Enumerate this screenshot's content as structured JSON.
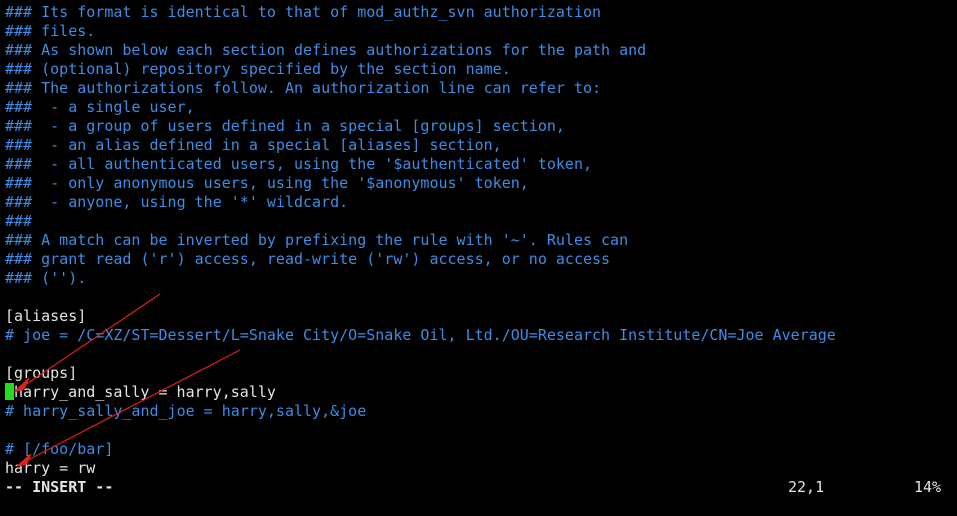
{
  "editor": {
    "mode": "terminal-vim",
    "colors": {
      "background": "#000000",
      "comment": "#3d8de6",
      "text": "#e5e5e5",
      "cursor": "#22dd22",
      "annotation_arrow": "#e0201a"
    }
  },
  "lines": [
    {
      "text": "### Its format is identical to that of mod_authz_svn authorization",
      "kind": "comment"
    },
    {
      "text": "### files.",
      "kind": "comment"
    },
    {
      "text": "### As shown below each section defines authorizations for the path and",
      "kind": "comment"
    },
    {
      "text": "### (optional) repository specified by the section name.",
      "kind": "comment"
    },
    {
      "text": "### The authorizations follow. An authorization line can refer to:",
      "kind": "comment"
    },
    {
      "text": "###  - a single user,",
      "kind": "comment"
    },
    {
      "text": "###  - a group of users defined in a special [groups] section,",
      "kind": "comment"
    },
    {
      "text": "###  - an alias defined in a special [aliases] section,",
      "kind": "comment"
    },
    {
      "text": "###  - all authenticated users, using the '$authenticated' token,",
      "kind": "comment"
    },
    {
      "text": "###  - only anonymous users, using the '$anonymous' token,",
      "kind": "comment"
    },
    {
      "text": "###  - anyone, using the '*' wildcard.",
      "kind": "comment"
    },
    {
      "text": "###",
      "kind": "comment"
    },
    {
      "text": "### A match can be inverted by prefixing the rule with '~'. Rules can",
      "kind": "comment"
    },
    {
      "text": "### grant read ('r') access, read-write ('rw') access, or no access",
      "kind": "comment"
    },
    {
      "text": "### ('').",
      "kind": "comment"
    },
    {
      "text": "",
      "kind": "normal"
    },
    {
      "text": "[aliases]",
      "kind": "normal"
    },
    {
      "text": "# joe = /C=XZ/ST=Dessert/L=Snake City/O=Snake Oil, Ltd./OU=Research Institute/CN=Joe Average",
      "kind": "comment"
    },
    {
      "text": "",
      "kind": "normal"
    },
    {
      "text": "[groups]",
      "kind": "normal"
    },
    {
      "text": "harry_and_sally = harry,sally",
      "kind": "normal",
      "cursor_before": true
    },
    {
      "text": "# harry_sally_and_joe = harry,sally,&joe",
      "kind": "comment"
    },
    {
      "text": "",
      "kind": "normal"
    },
    {
      "text": "# [/foo/bar]",
      "kind": "comment"
    },
    {
      "text": "harry = rw",
      "kind": "normal"
    }
  ],
  "status": {
    "mode_label": "-- INSERT --",
    "position": "22,1",
    "percent": "14%"
  }
}
